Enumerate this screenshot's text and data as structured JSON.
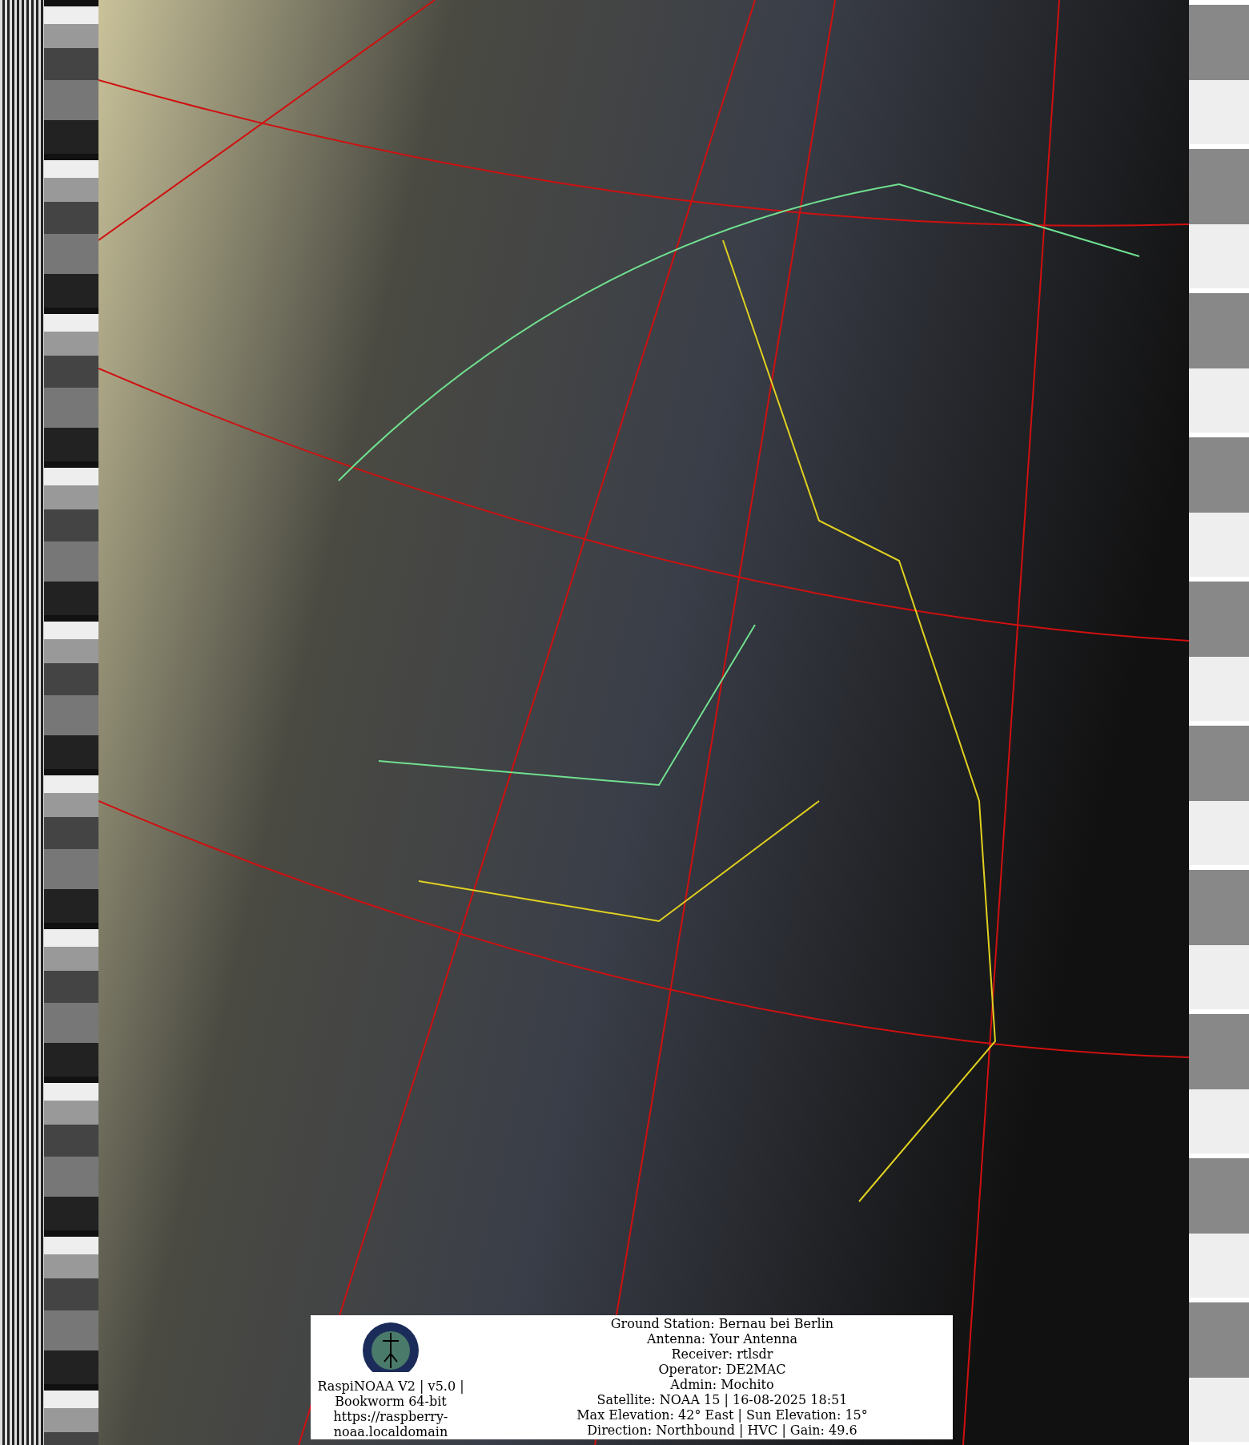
{
  "image": {
    "station_text": [
      "RaspiNOAA V2 | v5.0 |",
      "Bookworm 64-bit",
      "https://raspberry-",
      "noaa.localdomain"
    ],
    "details": [
      "Ground Station: Bernau bei Berlin",
      "Antenna: Your Antenna",
      "Receiver: rtlsdr",
      "Operator: DE2MAC",
      "Admin: Mochito",
      "Satellite: NOAA 15 | 16-08-2025 18:51",
      "Max Elevation: 42° East | Sun Elevation: 15°",
      "Direction: Northbound | HVC | Gain: 49.6"
    ]
  }
}
